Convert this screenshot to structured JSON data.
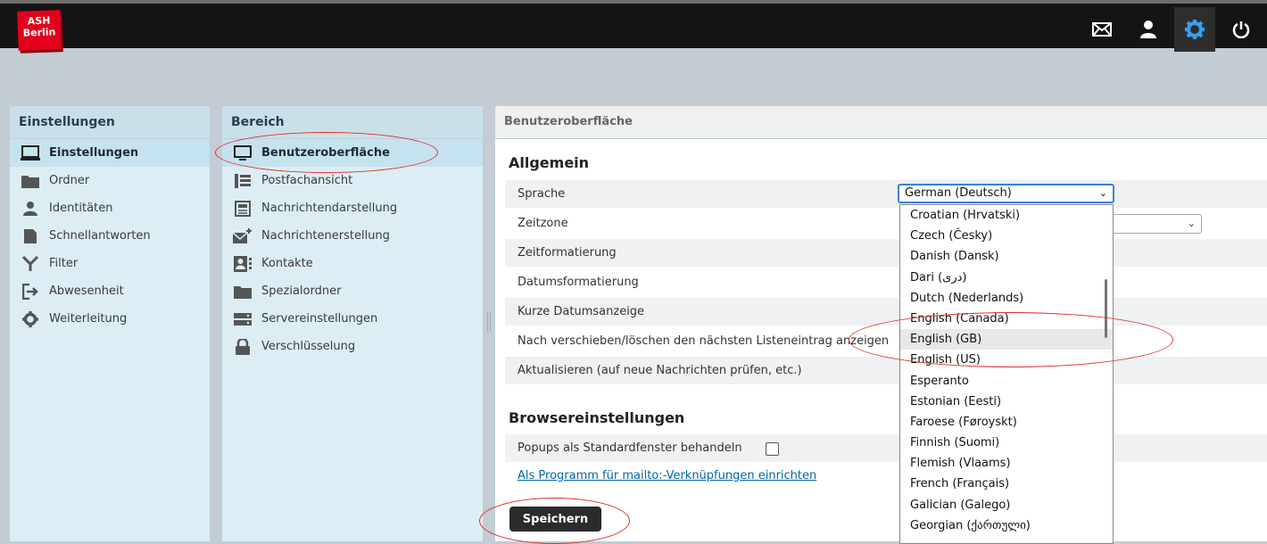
{
  "app": {
    "logo_line1": "ASH",
    "logo_line2": "Berlin",
    "brand_color": "#e3001b",
    "accent_color": "#3b7fe0",
    "top_icons": [
      "mail-icon",
      "user-icon",
      "gear-icon",
      "power-icon"
    ]
  },
  "settings_panel": {
    "header": "Einstellungen",
    "items": [
      {
        "label": "Einstellungen",
        "icon": "monitor-icon",
        "selected": true
      },
      {
        "label": "Ordner",
        "icon": "folder-icon"
      },
      {
        "label": "Identitäten",
        "icon": "person-icon"
      },
      {
        "label": "Schnellantworten",
        "icon": "document-icon"
      },
      {
        "label": "Filter",
        "icon": "filter-icon"
      },
      {
        "label": "Abwesenheit",
        "icon": "exit-icon"
      },
      {
        "label": "Weiterleitung",
        "icon": "gear-icon"
      }
    ]
  },
  "area_panel": {
    "header": "Bereich",
    "items": [
      {
        "label": "Benutzeroberfläche",
        "icon": "monitor-icon",
        "selected": true
      },
      {
        "label": "Postfachansicht",
        "icon": "list-icon"
      },
      {
        "label": "Nachrichtendarstellung",
        "icon": "newspaper-icon"
      },
      {
        "label": "Nachrichtenerstellung",
        "icon": "compose-mail-icon"
      },
      {
        "label": "Kontakte",
        "icon": "contact-card-icon"
      },
      {
        "label": "Spezialordner",
        "icon": "folder-icon"
      },
      {
        "label": "Servereinstellungen",
        "icon": "server-icon"
      },
      {
        "label": "Verschlüsselung",
        "icon": "lock-icon"
      }
    ]
  },
  "main": {
    "header": "Benutzeroberfläche",
    "section1_title": "Allgemein",
    "rows": [
      "Sprache",
      "Zeitzone",
      "Zeitformatierung",
      "Datumsformatierung",
      "Kurze Datumsanzeige",
      "Nach verschieben/löschen den nächsten Listeneintrag anzeigen",
      "Aktualisieren (auf neue Nachrichten prüfen, etc.)"
    ],
    "section2_title": "Browsereinstellungen",
    "popup_label": "Popups als Standardfenster behandeln",
    "popup_checked": false,
    "mailto_link": "Als Programm für mailto:-Verknüpfungen einrichten",
    "save_label": "Speichern"
  },
  "language_select": {
    "value": "German (Deutsch)",
    "options": [
      "Croatian (Hrvatski)",
      "Czech (Česky)",
      "Danish (Dansk)",
      "Dari (دری)",
      "Dutch (Nederlands)",
      "English (Canada)",
      "English (GB)",
      "English (US)",
      "Esperanto",
      "Estonian (Eesti)",
      "Faroese (Føroyskt)",
      "Finnish (Suomi)",
      "Flemish (Vlaams)",
      "French (Français)",
      "Galician (Galego)",
      "Georgian (ქართული)"
    ],
    "highlighted_index": 6
  }
}
